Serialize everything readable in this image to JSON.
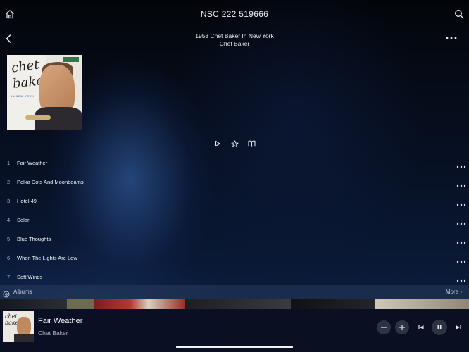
{
  "topbar": {
    "title": "NSC 222 519666",
    "home_icon": "home-icon",
    "search_icon": "search-icon"
  },
  "album_header": {
    "title": "1958 Chet Baker In New York",
    "artist": "Chet Baker",
    "back_icon": "chevron-left-icon",
    "more_icon": "more-horizontal-icon"
  },
  "cover": {
    "name_line1": "chet",
    "name_line2": "baker",
    "subtitle": "IN NEW YORK"
  },
  "actions": [
    {
      "icon": "play-icon"
    },
    {
      "icon": "star-icon"
    },
    {
      "icon": "book-icon"
    }
  ],
  "tracks": [
    {
      "number": "1",
      "name": "Fair Weather"
    },
    {
      "number": "2",
      "name": "Polka Dots And Moonbeams"
    },
    {
      "number": "3",
      "name": "Hotel 49"
    },
    {
      "number": "4",
      "name": "Solar"
    },
    {
      "number": "5",
      "name": "Blue Thoughts"
    },
    {
      "number": "6",
      "name": "When The Lights Are Low"
    },
    {
      "number": "7",
      "name": "Soft Winds"
    }
  ],
  "albums_bar": {
    "label": "Albums",
    "more": "More ›"
  },
  "now_playing": {
    "title": "Fair Weather",
    "artist": "Chet Baker",
    "cover_label": "chet baker"
  },
  "colors": {
    "background": "#05070d",
    "accent": "#2d3342"
  }
}
